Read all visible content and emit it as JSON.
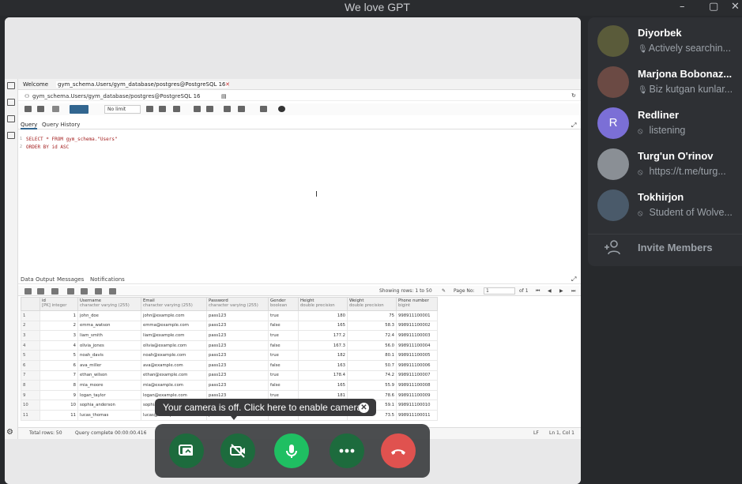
{
  "window": {
    "title": "We love GPT"
  },
  "pgadmin": {
    "tabs": [
      "Welcome",
      "gym_schema.Users/gym_database/postgres@PostgreSQL 16"
    ],
    "connection": "gym_schema.Users/gym_database/postgres@PostgreSQL 16",
    "limit_select": "No limit",
    "query_tabs": [
      "Query",
      "Query History"
    ],
    "sql_lines": [
      "SELECT * FROM gym_schema.\"Users\"",
      "ORDER BY id ASC"
    ],
    "output_tabs": [
      "Data Output",
      "Messages",
      "Notifications"
    ],
    "showing_rows": "Showing rows: 1 to 50",
    "page_label": "Page No:",
    "page_value": "1",
    "page_of": "of 1",
    "columns": [
      {
        "name": "id",
        "type": "[PK] integer"
      },
      {
        "name": "Username",
        "type": "character varying (255)"
      },
      {
        "name": "Email",
        "type": "character varying (255)"
      },
      {
        "name": "Password",
        "type": "character varying (255)"
      },
      {
        "name": "Gender",
        "type": "boolean"
      },
      {
        "name": "Height",
        "type": "double precision"
      },
      {
        "name": "Weight",
        "type": "double precision"
      },
      {
        "name": "Phone number",
        "type": "bigint"
      }
    ],
    "rows": [
      [
        "1",
        "1",
        "john_doe",
        "john@example.com",
        "pass123",
        "true",
        "180",
        "75",
        "998911100001"
      ],
      [
        "2",
        "2",
        "emma_watson",
        "emma@example.com",
        "pass123",
        "false",
        "165",
        "58.3",
        "998911100002"
      ],
      [
        "3",
        "3",
        "liam_smith",
        "liam@example.com",
        "pass123",
        "true",
        "177.2",
        "72.4",
        "998911100003"
      ],
      [
        "4",
        "4",
        "olivia_jones",
        "olivia@example.com",
        "pass123",
        "false",
        "167.3",
        "56.0",
        "998911100004"
      ],
      [
        "5",
        "5",
        "noah_davis",
        "noah@example.com",
        "pass123",
        "true",
        "182",
        "80.1",
        "998911100005"
      ],
      [
        "6",
        "6",
        "ava_miller",
        "ava@example.com",
        "pass123",
        "false",
        "163",
        "50.7",
        "998911100006"
      ],
      [
        "7",
        "7",
        "ethan_wilson",
        "ethan@example.com",
        "pass123",
        "true",
        "178.4",
        "74.2",
        "998911100007"
      ],
      [
        "8",
        "8",
        "mia_moore",
        "mia@example.com",
        "pass123",
        "false",
        "165",
        "55.9",
        "998911100008"
      ],
      [
        "9",
        "9",
        "logan_taylor",
        "logan@example.com",
        "pass123",
        "true",
        "181",
        "78.6",
        "998911100009"
      ],
      [
        "10",
        "10",
        "sophia_anderson",
        "sophia@example.com",
        "pass123",
        "false",
        "162",
        "59.1",
        "998911100010"
      ],
      [
        "11",
        "11",
        "lucas_thomas",
        "lucas@example.com",
        "pass123",
        "true",
        "173",
        "73.5",
        "998911100011"
      ]
    ],
    "total_rows": "Total rows: 50",
    "query_complete": "Query complete 00:00:00.416",
    "lf": "LF",
    "position": "Ln 1, Col 1"
  },
  "toast": {
    "text": "Your camera is off. Click here to enable camera."
  },
  "members": [
    {
      "name": "Diyorbek",
      "status": "Actively searchin...",
      "status_icon": "mic-icon",
      "color": "#5a5b3a"
    },
    {
      "name": "Marjona Bobonaz...",
      "status": "Biz kutgan kunlar...",
      "status_icon": "mic-icon",
      "color": "#6b4a44"
    },
    {
      "name": "Redliner",
      "status": "listening",
      "status_icon": "mic-off-icon",
      "initial": "R",
      "color": "#7b6fd6"
    },
    {
      "name": "Turg'un O'rinov",
      "status": "https://t.me/turg...",
      "status_icon": "mic-off-icon",
      "color": "#8a8f95"
    },
    {
      "name": "Tokhirjon",
      "status": "Student of Wolve...",
      "status_icon": "mic-off-icon",
      "color": "#4a5a6a"
    }
  ],
  "invite_label": "Invite Members",
  "colors": {
    "accent_green": "#1fbf62",
    "end_red": "#e0524f",
    "dark_green": "#1d6b3d"
  }
}
